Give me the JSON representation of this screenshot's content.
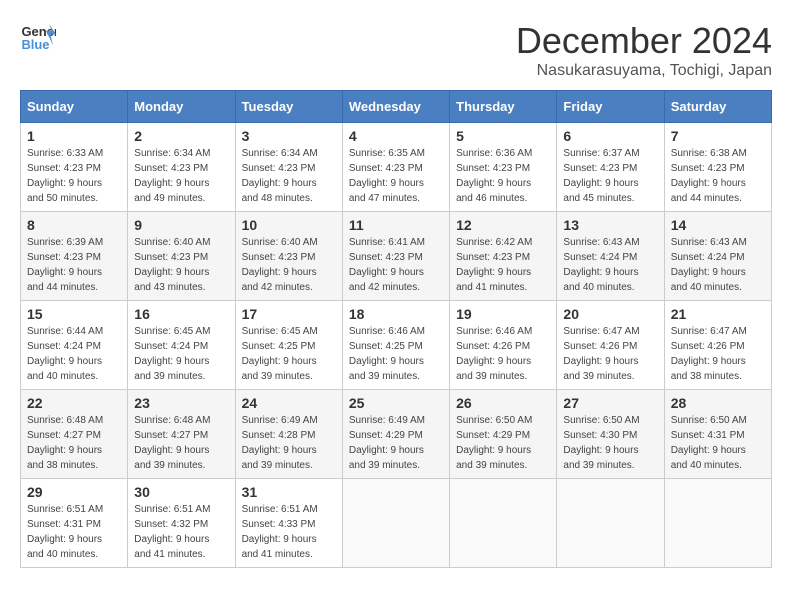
{
  "header": {
    "logo_line1": "General",
    "logo_line2": "Blue",
    "month_title": "December 2024",
    "subtitle": "Nasukarasuyama, Tochigi, Japan"
  },
  "weekdays": [
    "Sunday",
    "Monday",
    "Tuesday",
    "Wednesday",
    "Thursday",
    "Friday",
    "Saturday"
  ],
  "weeks": [
    [
      {
        "day": "1",
        "sunrise": "6:33 AM",
        "sunset": "4:23 PM",
        "daylight": "9 hours and 50 minutes."
      },
      {
        "day": "2",
        "sunrise": "6:34 AM",
        "sunset": "4:23 PM",
        "daylight": "9 hours and 49 minutes."
      },
      {
        "day": "3",
        "sunrise": "6:34 AM",
        "sunset": "4:23 PM",
        "daylight": "9 hours and 48 minutes."
      },
      {
        "day": "4",
        "sunrise": "6:35 AM",
        "sunset": "4:23 PM",
        "daylight": "9 hours and 47 minutes."
      },
      {
        "day": "5",
        "sunrise": "6:36 AM",
        "sunset": "4:23 PM",
        "daylight": "9 hours and 46 minutes."
      },
      {
        "day": "6",
        "sunrise": "6:37 AM",
        "sunset": "4:23 PM",
        "daylight": "9 hours and 45 minutes."
      },
      {
        "day": "7",
        "sunrise": "6:38 AM",
        "sunset": "4:23 PM",
        "daylight": "9 hours and 44 minutes."
      }
    ],
    [
      {
        "day": "8",
        "sunrise": "6:39 AM",
        "sunset": "4:23 PM",
        "daylight": "9 hours and 44 minutes."
      },
      {
        "day": "9",
        "sunrise": "6:40 AM",
        "sunset": "4:23 PM",
        "daylight": "9 hours and 43 minutes."
      },
      {
        "day": "10",
        "sunrise": "6:40 AM",
        "sunset": "4:23 PM",
        "daylight": "9 hours and 42 minutes."
      },
      {
        "day": "11",
        "sunrise": "6:41 AM",
        "sunset": "4:23 PM",
        "daylight": "9 hours and 42 minutes."
      },
      {
        "day": "12",
        "sunrise": "6:42 AM",
        "sunset": "4:23 PM",
        "daylight": "9 hours and 41 minutes."
      },
      {
        "day": "13",
        "sunrise": "6:43 AM",
        "sunset": "4:24 PM",
        "daylight": "9 hours and 40 minutes."
      },
      {
        "day": "14",
        "sunrise": "6:43 AM",
        "sunset": "4:24 PM",
        "daylight": "9 hours and 40 minutes."
      }
    ],
    [
      {
        "day": "15",
        "sunrise": "6:44 AM",
        "sunset": "4:24 PM",
        "daylight": "9 hours and 40 minutes."
      },
      {
        "day": "16",
        "sunrise": "6:45 AM",
        "sunset": "4:24 PM",
        "daylight": "9 hours and 39 minutes."
      },
      {
        "day": "17",
        "sunrise": "6:45 AM",
        "sunset": "4:25 PM",
        "daylight": "9 hours and 39 minutes."
      },
      {
        "day": "18",
        "sunrise": "6:46 AM",
        "sunset": "4:25 PM",
        "daylight": "9 hours and 39 minutes."
      },
      {
        "day": "19",
        "sunrise": "6:46 AM",
        "sunset": "4:26 PM",
        "daylight": "9 hours and 39 minutes."
      },
      {
        "day": "20",
        "sunrise": "6:47 AM",
        "sunset": "4:26 PM",
        "daylight": "9 hours and 39 minutes."
      },
      {
        "day": "21",
        "sunrise": "6:47 AM",
        "sunset": "4:26 PM",
        "daylight": "9 hours and 38 minutes."
      }
    ],
    [
      {
        "day": "22",
        "sunrise": "6:48 AM",
        "sunset": "4:27 PM",
        "daylight": "9 hours and 38 minutes."
      },
      {
        "day": "23",
        "sunrise": "6:48 AM",
        "sunset": "4:27 PM",
        "daylight": "9 hours and 39 minutes."
      },
      {
        "day": "24",
        "sunrise": "6:49 AM",
        "sunset": "4:28 PM",
        "daylight": "9 hours and 39 minutes."
      },
      {
        "day": "25",
        "sunrise": "6:49 AM",
        "sunset": "4:29 PM",
        "daylight": "9 hours and 39 minutes."
      },
      {
        "day": "26",
        "sunrise": "6:50 AM",
        "sunset": "4:29 PM",
        "daylight": "9 hours and 39 minutes."
      },
      {
        "day": "27",
        "sunrise": "6:50 AM",
        "sunset": "4:30 PM",
        "daylight": "9 hours and 39 minutes."
      },
      {
        "day": "28",
        "sunrise": "6:50 AM",
        "sunset": "4:31 PM",
        "daylight": "9 hours and 40 minutes."
      }
    ],
    [
      {
        "day": "29",
        "sunrise": "6:51 AM",
        "sunset": "4:31 PM",
        "daylight": "9 hours and 40 minutes."
      },
      {
        "day": "30",
        "sunrise": "6:51 AM",
        "sunset": "4:32 PM",
        "daylight": "9 hours and 41 minutes."
      },
      {
        "day": "31",
        "sunrise": "6:51 AM",
        "sunset": "4:33 PM",
        "daylight": "9 hours and 41 minutes."
      },
      null,
      null,
      null,
      null
    ]
  ],
  "labels": {
    "sunrise": "Sunrise:",
    "sunset": "Sunset:",
    "daylight": "Daylight:"
  }
}
